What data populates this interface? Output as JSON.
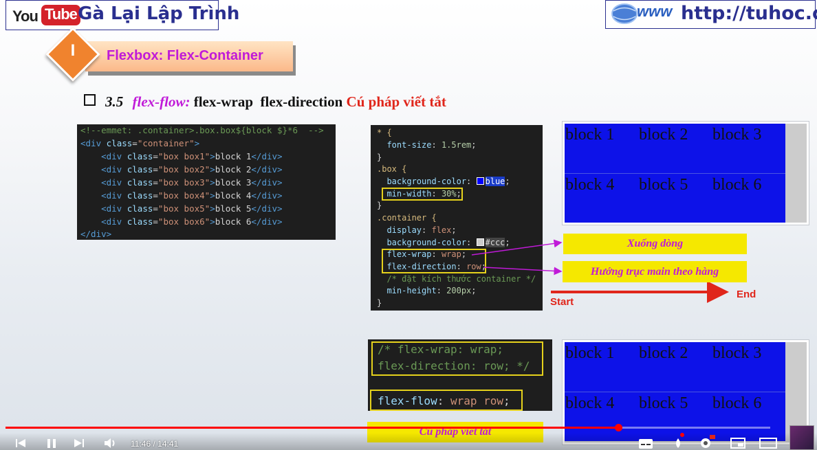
{
  "header": {
    "youtube_logo": {
      "you": "You",
      "tube": "Tube"
    },
    "channel_name": "Gà Lại Lập Trình",
    "site_logo_text": "www",
    "site_url": "http://tuhoc.cc"
  },
  "section": {
    "number": "I",
    "title": "Flexbox: Flex-Container"
  },
  "heading": {
    "number": "3.5",
    "property": "flex-flow:",
    "parts": "flex-wrap  flex-direction",
    "note": "Cú pháp viết tắt"
  },
  "html_code": {
    "comment": "<!--emmet: .container>.box.box${block $}*6  -->",
    "open_tag": {
      "lt": "<",
      "tag": "div",
      "attr": "class",
      "eq": "=",
      "value": "\"container\"",
      "gt": ">"
    },
    "children": [
      {
        "value": "\"box box1\"",
        "text": "block 1"
      },
      {
        "value": "\"box box2\"",
        "text": "block 2"
      },
      {
        "value": "\"box box3\"",
        "text": "block 3"
      },
      {
        "value": "\"box box4\"",
        "text": "block 4"
      },
      {
        "value": "\"box box5\"",
        "text": "block 5"
      },
      {
        "value": "\"box box6\"",
        "text": "block 6"
      }
    ],
    "close_tag": "</div>"
  },
  "css_code": {
    "l1_sel": "* {",
    "l2_prop": "font-size",
    "l2_val": "1.5rem",
    "l3": "}",
    "l4_sel": ".box {",
    "l5_prop": "background-color",
    "l5_val": "blue",
    "l6_prop": "min-width",
    "l6_val": "30%",
    "l7": "}",
    "l8_sel": ".container {",
    "l9_prop": "display",
    "l9_val": "flex",
    "l10_prop": "background-color",
    "l10_val": "#ccc",
    "l11_prop": "flex-wrap",
    "l11_val": "wrap",
    "l12_prop": "flex-direction",
    "l12_val": "row",
    "l13_comment": "/* đặt kích thước container */",
    "l14_prop": "min-height",
    "l14_val": "200px",
    "l15": "}"
  },
  "demo_blocks": [
    "block 1",
    "block 2",
    "block 3",
    "block 4",
    "block 5",
    "block 6"
  ],
  "annotations": {
    "wrap_label": "Xuống dòng",
    "direction_label": "Hướng trục main theo hàng",
    "start": "Start",
    "end": "End",
    "shorthand_label": "Cú pháp viết tắt"
  },
  "shorthand_code": {
    "comment_line1": "/* flex-wrap: wrap;",
    "comment_line2": "flex-direction: row; */",
    "prop": "flex-flow",
    "val": "wrap row"
  },
  "player": {
    "current_time": "11:46",
    "duration": "14:41",
    "time_display": "11:46 / 14:41",
    "progress": 0.801
  },
  "colors": {
    "accent_purple": "#c01ad8",
    "red": "#e0261b",
    "block_blue": "#0d12e8",
    "label_yellow": "#f5e800",
    "brand_navy": "#2a2f8f"
  }
}
